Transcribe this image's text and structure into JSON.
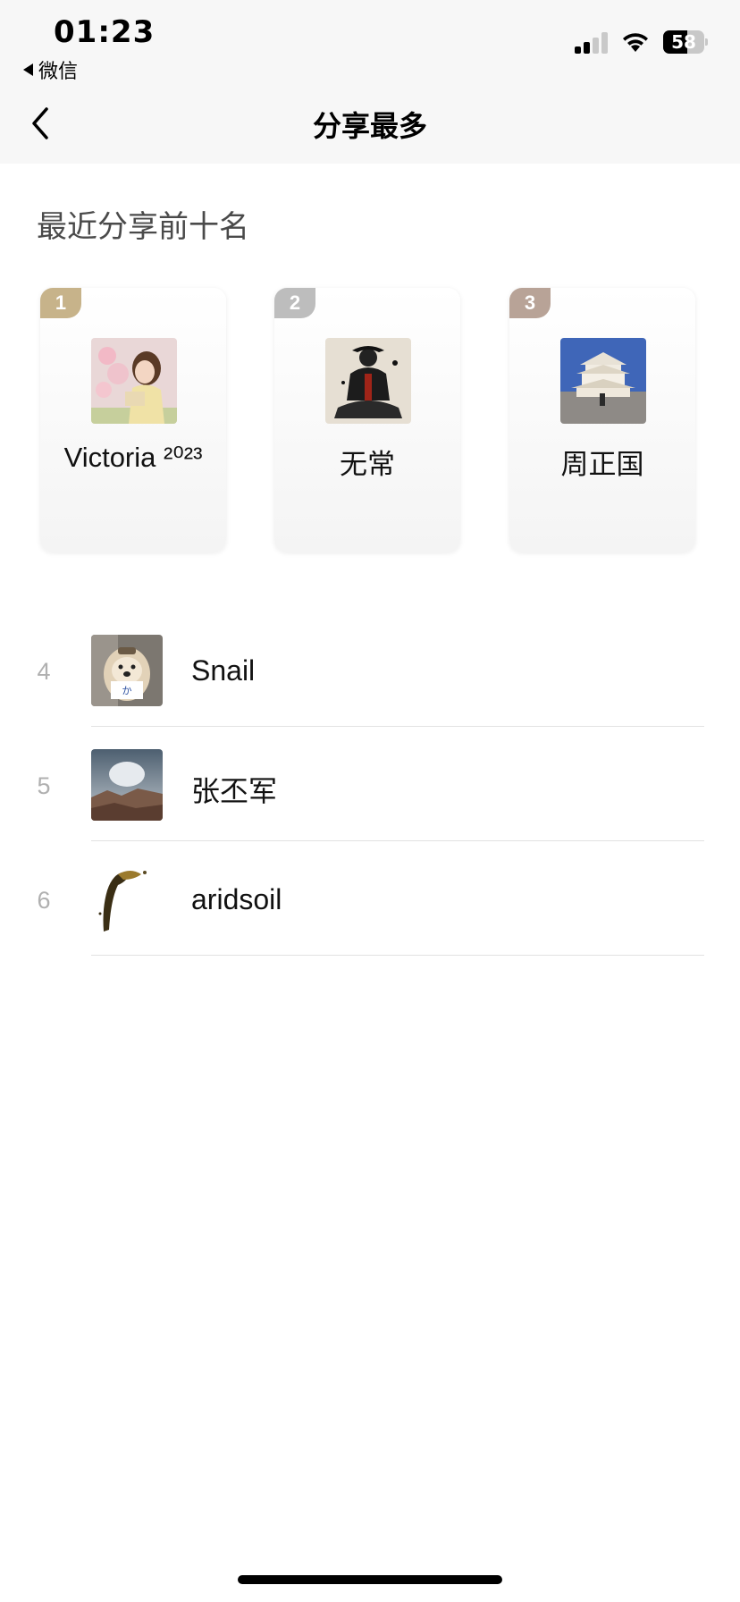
{
  "status_bar": {
    "time": "01:23",
    "back_app_label": "微信",
    "battery_percent": "58",
    "battery_level": 0.58,
    "signal_bars_active": 2,
    "signal_bars_total": 4
  },
  "nav": {
    "back_icon": "chevron-left-icon",
    "title": "分享最多"
  },
  "section": {
    "title": "最近分享前十名"
  },
  "top3": [
    {
      "rank": "1",
      "name": "Victoria ²⁰²³",
      "badge_color": "#c7b38a",
      "avatar": "woman-illustration"
    },
    {
      "rank": "2",
      "name": "无常",
      "badge_color": "#bdbdbd",
      "avatar": "warrior-ink-illustration"
    },
    {
      "rank": "3",
      "name": "周正国",
      "badge_color": "#b8a397",
      "avatar": "pagoda-photo"
    }
  ],
  "list": [
    {
      "rank": "4",
      "name": "Snail",
      "avatar": "dog-photo"
    },
    {
      "rank": "5",
      "name": "张丕军",
      "avatar": "cloudy-canyon-photo"
    },
    {
      "rank": "6",
      "name": "aridsoil",
      "avatar": "ink-splash-image"
    }
  ],
  "colors": {
    "topbar_bg": "#f7f7f7",
    "page_bg": "#ffffff",
    "rank_number_gray": "#b0b0b0",
    "divider": "#e2e2e2"
  }
}
